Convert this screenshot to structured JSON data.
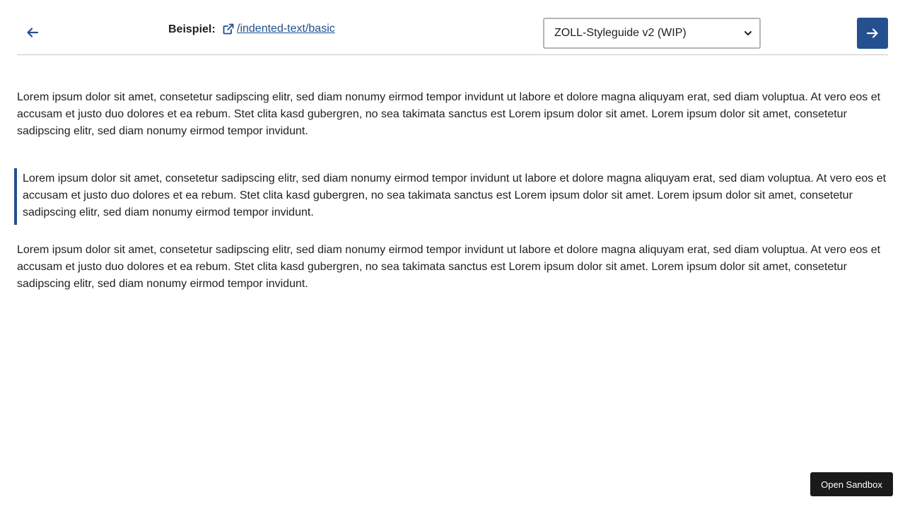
{
  "header": {
    "back_icon": "arrow-left-icon",
    "example_label": "Beispiel:",
    "example_link_icon": "external-link-icon",
    "example_link_text": "/indented-text/basic",
    "theme_select": {
      "selected": "ZOLL-Styleguide v2 (WIP)"
    },
    "next_icon": "arrow-right-icon"
  },
  "content": {
    "paragraph_1": "Lorem ipsum dolor sit amet, consetetur sadipscing elitr, sed diam nonumy eirmod tempor invidunt ut labore et dolore magna aliquyam erat, sed diam voluptua. At vero eos et accusam et justo duo dolores et ea rebum. Stet clita kasd gubergren, no sea takimata sanctus est Lorem ipsum dolor sit amet. Lorem ipsum dolor sit amet, consetetur sadipscing elitr, sed diam nonumy eirmod tempor invidunt.",
    "indented_paragraph": "Lorem ipsum dolor sit amet, consetetur sadipscing elitr, sed diam nonumy eirmod tempor invidunt ut labore et dolore magna aliquyam erat, sed diam voluptua. At vero eos et accusam et justo duo dolores et ea rebum. Stet clita kasd gubergren, no sea takimata sanctus est Lorem ipsum dolor sit amet. Lorem ipsum dolor sit amet, consetetur sadipscing elitr, sed diam nonumy eirmod tempor invidunt.",
    "paragraph_3": "Lorem ipsum dolor sit amet, consetetur sadipscing elitr, sed diam nonumy eirmod tempor invidunt ut labore et dolore magna aliquyam erat, sed diam voluptua. At vero eos et accusam et justo duo dolores et ea rebum. Stet clita kasd gubergren, no sea takimata sanctus est Lorem ipsum dolor sit amet. Lorem ipsum dolor sit amet, consetetur sadipscing elitr, sed diam nonumy eirmod tempor invidunt."
  },
  "sandbox_button_label": "Open Sandbox",
  "colors": {
    "accent": "#24508f",
    "link": "#1f4f8f",
    "text": "#1f1f1f",
    "sandbox_bg": "#1a1a1a"
  }
}
